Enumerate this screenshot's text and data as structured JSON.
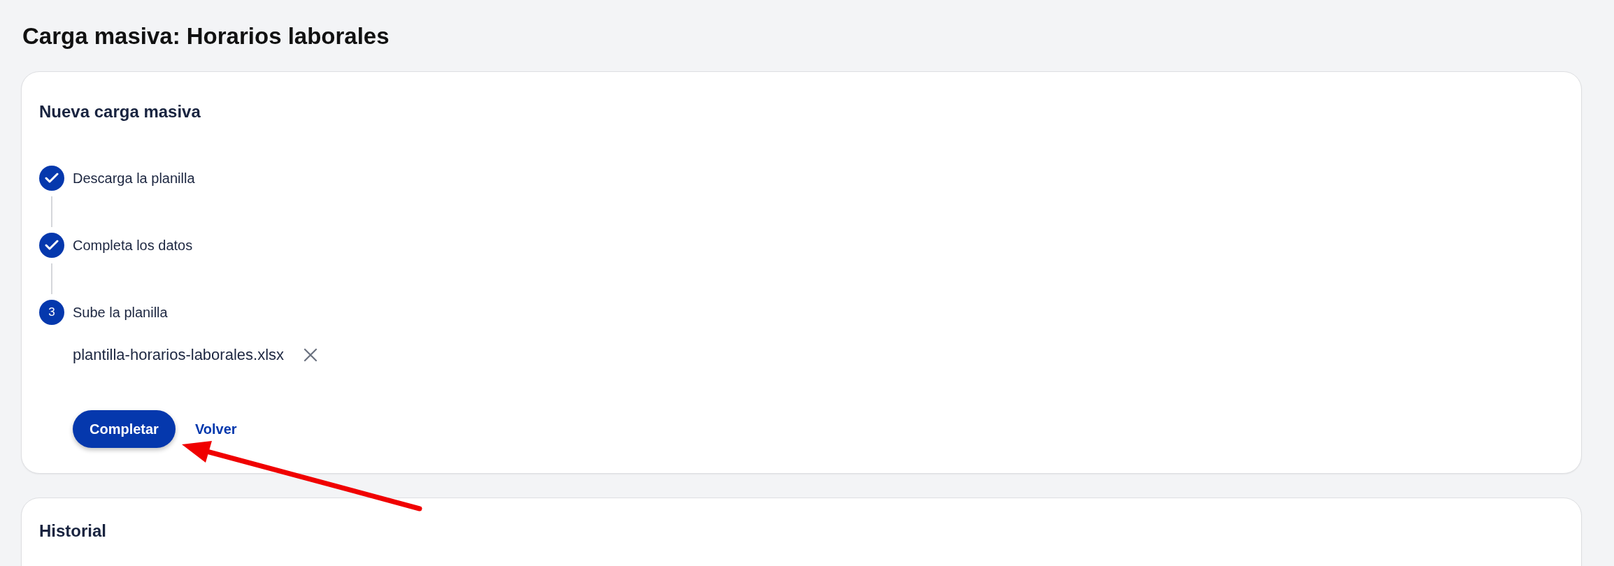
{
  "page": {
    "title": "Carga masiva: Horarios laborales"
  },
  "upload_card": {
    "title": "Nueva carga masiva",
    "steps": [
      {
        "label": "Descarga la planilla",
        "kind": "done"
      },
      {
        "label": "Completa los datos",
        "kind": "done"
      },
      {
        "label": "Sube la planilla",
        "kind": "current",
        "number": "3"
      }
    ],
    "file": {
      "name": "plantilla-horarios-laborales.xlsx"
    },
    "buttons": [
      {
        "label": "Completar",
        "kind": "primary"
      },
      {
        "label": "Volver",
        "kind": "link"
      }
    ]
  },
  "history_card": {
    "title": "Historial"
  }
}
